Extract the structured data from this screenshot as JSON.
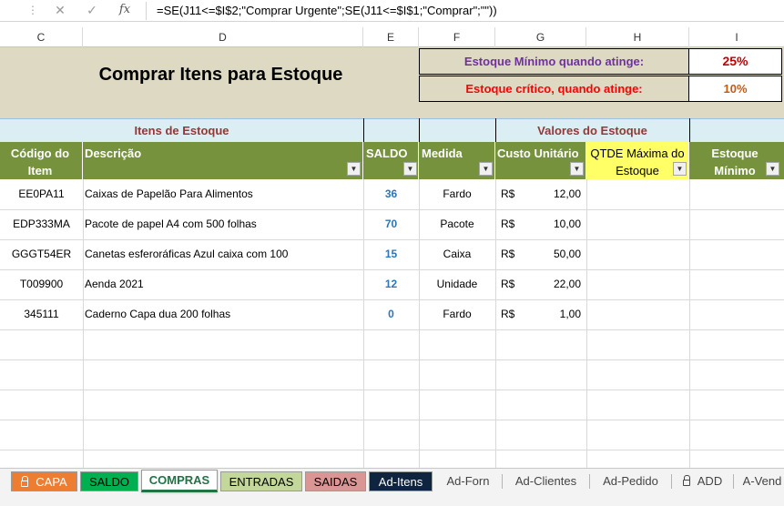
{
  "formula_bar": {
    "cancel": "✕",
    "enter": "✓",
    "fx": "fx",
    "formula": "=SE(J11<=$I$2;\"Comprar Urgente\";SE(J11<=$I$1;\"Comprar\";\"\"))"
  },
  "columns": [
    "C",
    "D",
    "E",
    "F",
    "G",
    "H",
    "I"
  ],
  "header": {
    "title": "Comprar Itens para Estoque",
    "min_label": "Estoque Mínimo quando atinge:",
    "min_value": "25%",
    "crit_label": "Estoque crítico, quando atinge:",
    "crit_value": "10%"
  },
  "sections": {
    "items": "Itens de Estoque",
    "values": "Valores do Estoque"
  },
  "table_headers": {
    "code": "Código do Item",
    "desc": "Descrição",
    "saldo": "SALDO",
    "medida": "Medida",
    "custo": "Custo Unitário",
    "qtde": "QTDE Máxima do Estoque",
    "minimo": "Estoque Mínimo"
  },
  "rows": [
    {
      "code": "EE0PA11",
      "desc": "Caixas de Papelão Para Alimentos",
      "saldo": "36",
      "medida": "Fardo",
      "cur": "R$",
      "custo": "12,00"
    },
    {
      "code": "EDP333MA",
      "desc": "Pacote de papel A4 com 500 folhas",
      "saldo": "70",
      "medida": "Pacote",
      "cur": "R$",
      "custo": "10,00"
    },
    {
      "code": "GGGT54ER",
      "desc": "Canetas esferoráficas Azul caixa com 100",
      "saldo": "15",
      "medida": "Caixa",
      "cur": "R$",
      "custo": "50,00"
    },
    {
      "code": "T009900",
      "desc": "Aenda 2021",
      "saldo": "12",
      "medida": "Unidade",
      "cur": "R$",
      "custo": "22,00"
    },
    {
      "code": "345111",
      "desc": "Caderno Capa dua 200 folhas",
      "saldo": "0",
      "medida": "Fardo",
      "cur": "R$",
      "custo": "1,00"
    }
  ],
  "tabs": [
    {
      "label": "CAPA",
      "bg": "#ed7d31",
      "color": "#ffffff",
      "locked": true
    },
    {
      "label": "SALDO",
      "bg": "#00b050",
      "color": "#000000",
      "locked": false
    },
    {
      "label": "COMPRAS",
      "bg": "#ffffff",
      "color": "#217346",
      "locked": false,
      "active": true
    },
    {
      "label": "ENTRADAS",
      "bg": "#c4d79b",
      "color": "#000000",
      "locked": false
    },
    {
      "label": "SAIDAS",
      "bg": "#da9694",
      "color": "#000000",
      "locked": false
    },
    {
      "label": "Ad-Itens",
      "bg": "#0f243e",
      "color": "#ffffff",
      "locked": false
    },
    {
      "label": "Ad-Forn",
      "bg": "",
      "color": "#444444",
      "locked": false
    },
    {
      "label": "Ad-Clientes",
      "bg": "",
      "color": "#444444",
      "locked": false
    },
    {
      "label": "Ad-Pedido",
      "bg": "",
      "color": "#444444",
      "locked": false
    },
    {
      "label": "ADD",
      "bg": "",
      "color": "#444444",
      "locked": true
    },
    {
      "label": "A-Vend",
      "bg": "",
      "color": "#444444",
      "locked": false
    }
  ],
  "colors": {
    "header_tan": "#ddd9c3",
    "table_green": "#76923c",
    "section_blue": "#daeef3",
    "section_text": "#953735",
    "min_label": "#7030a0",
    "crit_label": "#ff0000",
    "percent": "#c55a11",
    "saldo": "#2e75b6",
    "qtde_header": "#ffff66"
  }
}
